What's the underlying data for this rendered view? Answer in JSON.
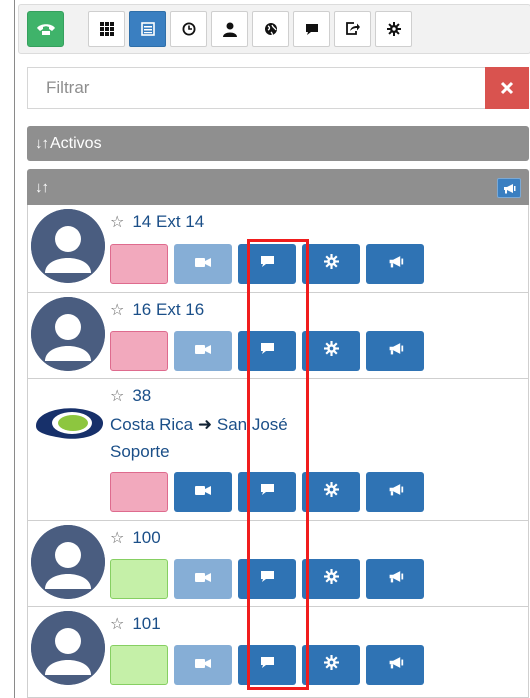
{
  "toolbar": {
    "buttons": [
      {
        "icon": "phone-icon"
      },
      {
        "icon": "grid-icon"
      },
      {
        "icon": "list-icon",
        "active": true
      },
      {
        "icon": "clock-icon"
      },
      {
        "icon": "user-icon"
      },
      {
        "icon": "globe-icon"
      },
      {
        "icon": "chat-icon"
      },
      {
        "icon": "share-icon"
      },
      {
        "icon": "gear-icon"
      }
    ]
  },
  "filter": {
    "placeholder": "Filtrar",
    "value": "",
    "clear_icon": "close-icon"
  },
  "activos_bar": {
    "label": "Activos",
    "icon": "sort-icon"
  },
  "list_bar": {
    "icon": "sort-icon",
    "action_icon": "megaphone-icon"
  },
  "contacts": [
    {
      "name": "14 Ext 14",
      "status": "busy",
      "avatar": "user-avatar",
      "video_enabled": false
    },
    {
      "name": "16 Ext 16",
      "status": "busy",
      "avatar": "user-avatar",
      "video_enabled": false
    },
    {
      "name": "38",
      "line2": "Costa Rica",
      "arrow_icon": "arrow-right-icon",
      "line2b": "San José",
      "line3": "Soporte",
      "status": "busy",
      "avatar": "company-logo",
      "video_enabled": true
    },
    {
      "name": "100",
      "status": "available",
      "avatar": "user-avatar",
      "video_enabled": false
    },
    {
      "name": "101",
      "status": "available",
      "avatar": "user-avatar",
      "video_enabled": false
    }
  ],
  "colors": {
    "accent_blue": "#2f73b4",
    "status_busy": "#f2a9bd",
    "status_available": "#c5f0a8",
    "clear_red": "#d9534f",
    "highlight_red": "#f01d1d"
  }
}
